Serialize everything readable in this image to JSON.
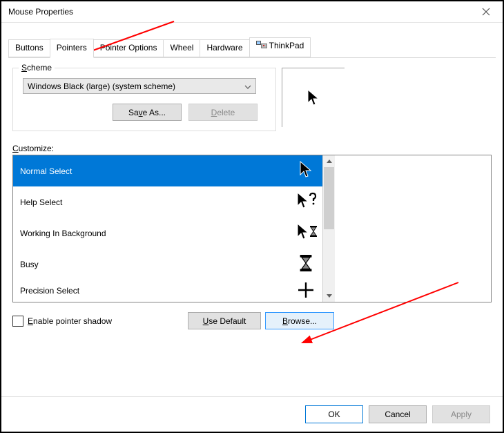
{
  "window": {
    "title": "Mouse Properties"
  },
  "tabs": {
    "buttons": "Buttons",
    "pointers": "Pointers",
    "pointer_options": "Pointer Options",
    "wheel": "Wheel",
    "hardware": "Hardware",
    "thinkpad": "ThinkPad"
  },
  "scheme": {
    "group_label": "Scheme",
    "selected": "Windows Black (large) (system scheme)",
    "save_as": "Save As...",
    "delete": "Delete"
  },
  "customize": {
    "label": "Customize:",
    "items": [
      {
        "name": "Normal Select"
      },
      {
        "name": "Help Select"
      },
      {
        "name": "Working In Background"
      },
      {
        "name": "Busy"
      },
      {
        "name": "Precision Select"
      }
    ]
  },
  "shadow": {
    "label": "Enable pointer shadow"
  },
  "buttons": {
    "use_default": "Use Default",
    "browse": "Browse..."
  },
  "footer": {
    "ok": "OK",
    "cancel": "Cancel",
    "apply": "Apply"
  }
}
